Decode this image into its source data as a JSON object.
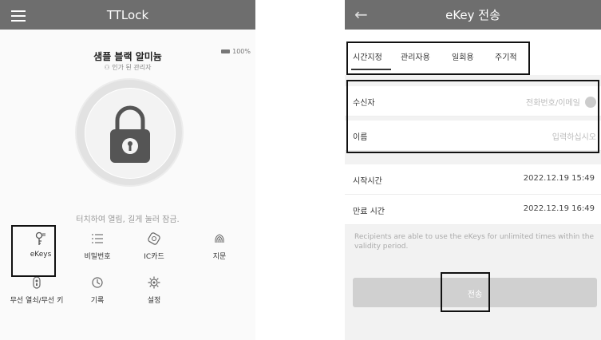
{
  "left": {
    "app_title": "TTLock",
    "lock_name": "샘플 블랙 알미늄",
    "lock_role": "인가 된 관리자",
    "battery": "100%",
    "hint": "터치하여 열림, 길게 눌러 잠금.",
    "menu": [
      {
        "label": "eKeys",
        "icon": "ekey-icon"
      },
      {
        "label": "비밀번호",
        "icon": "passcode-icon"
      },
      {
        "label": "IC카드",
        "icon": "ic-card-icon"
      },
      {
        "label": "지문",
        "icon": "fingerprint-icon"
      },
      {
        "label": "무선 열쇠/무선 키",
        "icon": "wireless-keyfob-icon"
      },
      {
        "label": "기록",
        "icon": "history-icon"
      },
      {
        "label": "설정",
        "icon": "settings-gear-icon"
      }
    ]
  },
  "right": {
    "title": "eKey 전송",
    "back_icon": "back-arrow-icon",
    "tabs": [
      "시간지정",
      "관리자용",
      "일회용",
      "주기적"
    ],
    "active_tab": "시간지정",
    "recipient_label": "수신자",
    "recipient_placeholder": "전화번호/이메일",
    "name_label": "이름",
    "name_placeholder": "입력하십시오",
    "start_label": "시작시간",
    "start_value": "2022.12.19 15:49",
    "end_label": "만료 시간",
    "end_value": "2022.12.19 16:49",
    "note": "Recipients are able to use the eKeys for unlimited times within the validity period.",
    "send_label": "전송"
  }
}
